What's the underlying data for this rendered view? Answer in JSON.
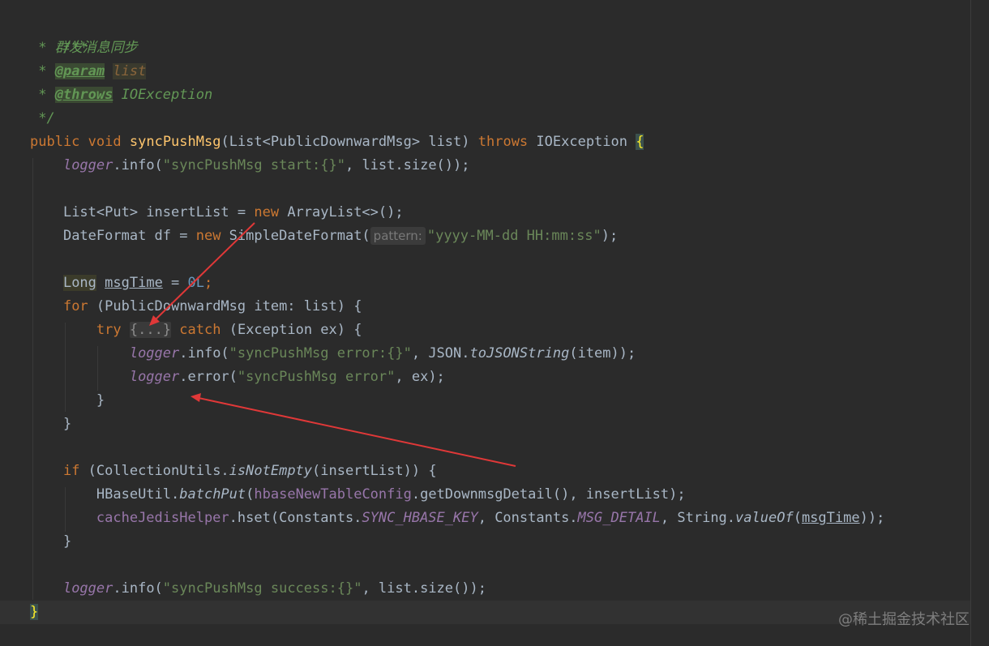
{
  "colors": {
    "background": "#2b2b2b",
    "arrow": "#e03838"
  },
  "code": {
    "doc_open": "/**",
    "doc_summary_prefix": " * ",
    "doc_summary": "群发消息同步",
    "doc_star": " * ",
    "param_tag": "@param",
    "param_name": "list",
    "throws_tag": "@throws",
    "throws_type": "IOException",
    "doc_close": " */",
    "kw_public": "public",
    "kw_void": "void",
    "method_name": "syncPushMsg",
    "sig_params": "(List<PublicDownwardMsg> list) ",
    "kw_throws": "throws",
    "sig_exception": " IOException ",
    "open_brace": "{",
    "logger": "logger",
    "dot_info": ".info(",
    "dot_error": ".error(",
    "str_start": "\"syncPushMsg start:{}\"",
    "list_size_call": ", list.size());",
    "insert_list_decl": "List<Put> insertList = ",
    "kw_new": "new",
    "arraylist_ctor": " ArrayList<>();",
    "dateformat_decl": "DateFormat df = ",
    "sdf_ctor": " SimpleDateFormat(",
    "hint_pattern": "pattern:",
    "str_pattern": "\"yyyy-MM-dd HH:mm:ss\"",
    "close_paren_semi": ");",
    "type_long": "Long",
    "var_msgtime": "msgTime",
    "assign": " = ",
    "num_zero": "0L",
    "semi": ";",
    "kw_for": "for",
    "for_header": " (PublicDownwardMsg item: list) {",
    "kw_try": "try",
    "fold_block": "{...}",
    "kw_catch": "catch",
    "catch_header": " (Exception ex) {",
    "str_error_fmt": "\"syncPushMsg error:{}\"",
    "json_class": ", JSON.",
    "to_json_string": "toJSONString",
    "item_arg_close": "(item));",
    "str_error": "\"syncPushMsg error\"",
    "ex_arg_close": ", ex);",
    "close_brace": "}",
    "kw_if": "if",
    "if_header_prefix": " (CollectionUtils.",
    "is_not_empty": "isNotEmpty",
    "if_header_suffix": "(insertList)) {",
    "hbase_util": "HBaseUtil.",
    "batch_put": "batchPut",
    "paren_open": "(",
    "hbase_config_field": "hbaseNewTableConfig",
    "get_downmsg_detail": ".getDownmsgDetail(), insertList);",
    "cache_helper_field": "cacheJedisHelper",
    "hset_call": ".hset(Constants.",
    "sync_hbase_key": "SYNC_HBASE_KEY",
    "constants_sep": ", Constants.",
    "msg_detail": "MSG_DETAIL",
    "string_class": ", String.",
    "value_of": "valueOf",
    "close_two_semi": "));",
    "str_success": "\"syncPushMsg success:{}\"",
    "final_brace": "}"
  },
  "watermark": "@稀土掘金技术社区"
}
